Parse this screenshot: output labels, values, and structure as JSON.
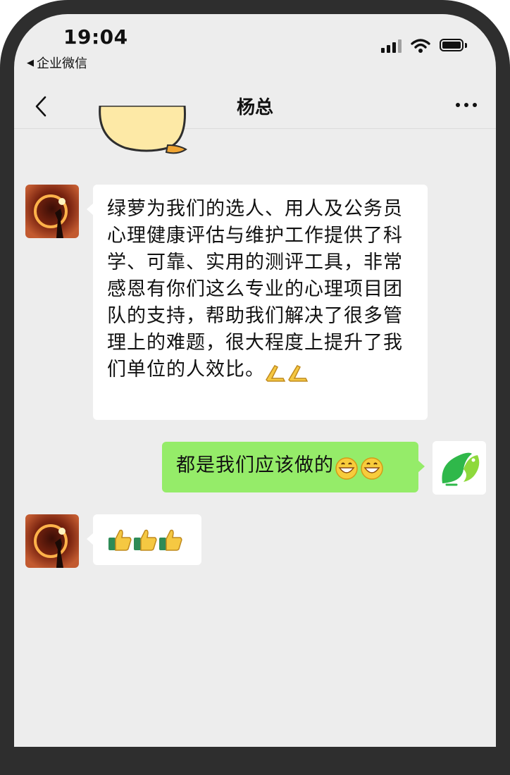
{
  "status_bar": {
    "time": "19:04",
    "back_app": "企业微信"
  },
  "nav": {
    "title": "杨总"
  },
  "messages": [
    {
      "direction": "in",
      "text": "绿萝为我们的选人、用人及公务员心理健康评估与维护工作提供了科学、可靠、实用的测评工具，非常感恩有你们这么专业的心理项目团队的支持，帮助我们解决了很多管理上的难题，很大程度上提升了我们单位的人效比。",
      "emoji": [
        "praying-hands",
        "praying-hands"
      ]
    },
    {
      "direction": "out",
      "text": "都是我们应该做的",
      "emoji": [
        "grinning-face",
        "grinning-face"
      ]
    },
    {
      "direction": "in",
      "text": "",
      "emoji": [
        "thumbs-up",
        "thumbs-up",
        "thumbs-up"
      ]
    }
  ],
  "colors": {
    "chat_background": "#ededed",
    "incoming_bubble": "#ffffff",
    "outgoing_bubble": "#95ec69",
    "logo_green": "#2fb84a"
  }
}
